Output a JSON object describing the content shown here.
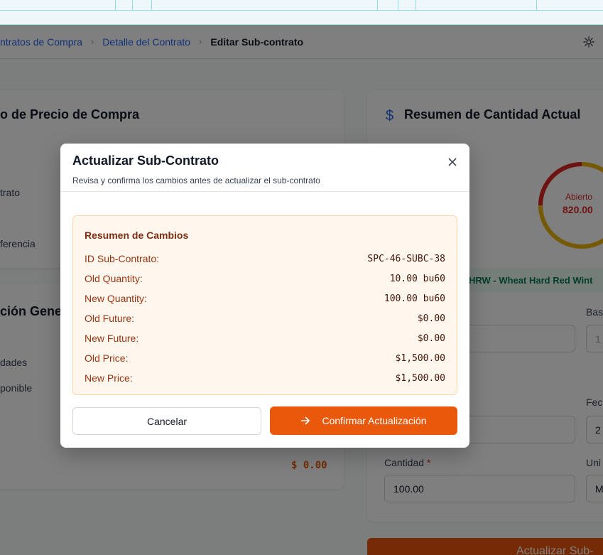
{
  "breadcrumb": {
    "items": [
      "ntratos de Compra",
      "Detalle del Contrato"
    ],
    "current": "Editar Sub-contrato"
  },
  "left_card": {
    "title": "o de Precio de Compra",
    "lines": [
      "trato",
      "ferencia"
    ]
  },
  "left_card2": {
    "title": "ción Gener",
    "lines": [
      "dades",
      "ponible"
    ],
    "amount": "$ 0.00"
  },
  "right_card": {
    "title": "Resumen de Cantidad Actual",
    "gauge_label": "Abierto",
    "gauge_value": "820.00",
    "commodity": "HRW - Wheat Hard Red Wint",
    "partial_labels": [
      "Bas",
      "Fec",
      "Uni"
    ],
    "partial_values": [
      "1",
      "2",
      "M"
    ],
    "quantity_label": "Cantidad",
    "quantity_required": "*",
    "quantity_value": "100.00",
    "submit_label": "Actualizar Sub-"
  },
  "modal": {
    "title": "Actualizar Sub-Contrato",
    "subtitle": "Revisa y confirma los cambios antes de actualizar el sub-contrato",
    "summary_title": "Resumen de Cambios",
    "rows": [
      {
        "label": "ID Sub-Contrato:",
        "value": "SPC-46-SUBC-38"
      },
      {
        "label": "Old Quantity:",
        "value": "10.00 bu60"
      },
      {
        "label": "New Quantity:",
        "value": "100.00 bu60"
      },
      {
        "label": "Old Future:",
        "value": "$0.00"
      },
      {
        "label": "New Future:",
        "value": "$0.00"
      },
      {
        "label": "Old Price:",
        "value": "$1,500.00"
      },
      {
        "label": "New Price:",
        "value": "$1,500.00"
      }
    ],
    "cancel_label": "Cancelar",
    "confirm_label": "Confirmar Actualización"
  },
  "colors": {
    "accent": "#ea580c",
    "link": "#2563eb",
    "summary_bg": "#fff7ed",
    "gauge_open": "#dc2626",
    "gauge_other": "#eab308"
  },
  "icons": [
    "gear-icon",
    "close-icon",
    "arrow-right-icon",
    "dollar-icon"
  ]
}
